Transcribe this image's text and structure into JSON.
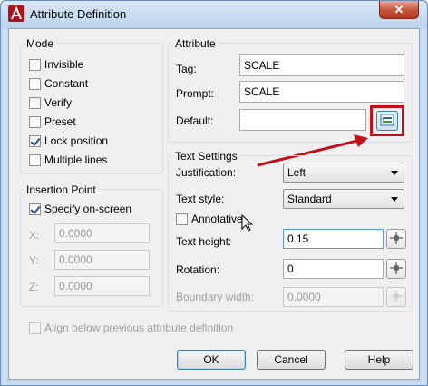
{
  "window": {
    "title": "Attribute Definition",
    "close_symbol": "✕"
  },
  "mode": {
    "label": "Mode",
    "items": [
      {
        "label": "Invisible",
        "checked": false
      },
      {
        "label": "Constant",
        "checked": false
      },
      {
        "label": "Verify",
        "checked": false
      },
      {
        "label": "Preset",
        "checked": false
      },
      {
        "label": "Lock position",
        "checked": true
      },
      {
        "label": "Multiple lines",
        "checked": false
      }
    ]
  },
  "attribute": {
    "label": "Attribute",
    "tag_label": "Tag:",
    "tag_value": "SCALE",
    "prompt_label": "Prompt:",
    "prompt_value": "SCALE",
    "default_label": "Default:",
    "default_value": ""
  },
  "insertion_point": {
    "label": "Insertion Point",
    "specify_label": "Specify on-screen",
    "specify_checked": true,
    "x_label": "X:",
    "x_value": "0.0000",
    "y_label": "Y:",
    "y_value": "0.0000",
    "z_label": "Z:",
    "z_value": "0.0000"
  },
  "text_settings": {
    "label": "Text Settings",
    "justification_label": "Justification:",
    "justification_value": "Left",
    "text_style_label": "Text style:",
    "text_style_value": "Standard",
    "annotative_label": "Annotative",
    "annotative_checked": false,
    "text_height_label": "Text height:",
    "text_height_value": "0.15",
    "rotation_label": "Rotation:",
    "rotation_value": "0",
    "boundary_width_label": "Boundary width:",
    "boundary_width_value": "0.0000"
  },
  "align_below": {
    "label": "Align below previous attribute definition",
    "checked": false
  },
  "buttons": {
    "ok": "OK",
    "cancel": "Cancel",
    "help": "Help"
  },
  "colors": {
    "annotation_red": "#c0111a",
    "accent_blue": "#3c7fb1"
  },
  "icons": {
    "app": "autocad-icon",
    "insert_field": "insert-field-icon",
    "pick_point": "crosshair-pick-icon"
  }
}
